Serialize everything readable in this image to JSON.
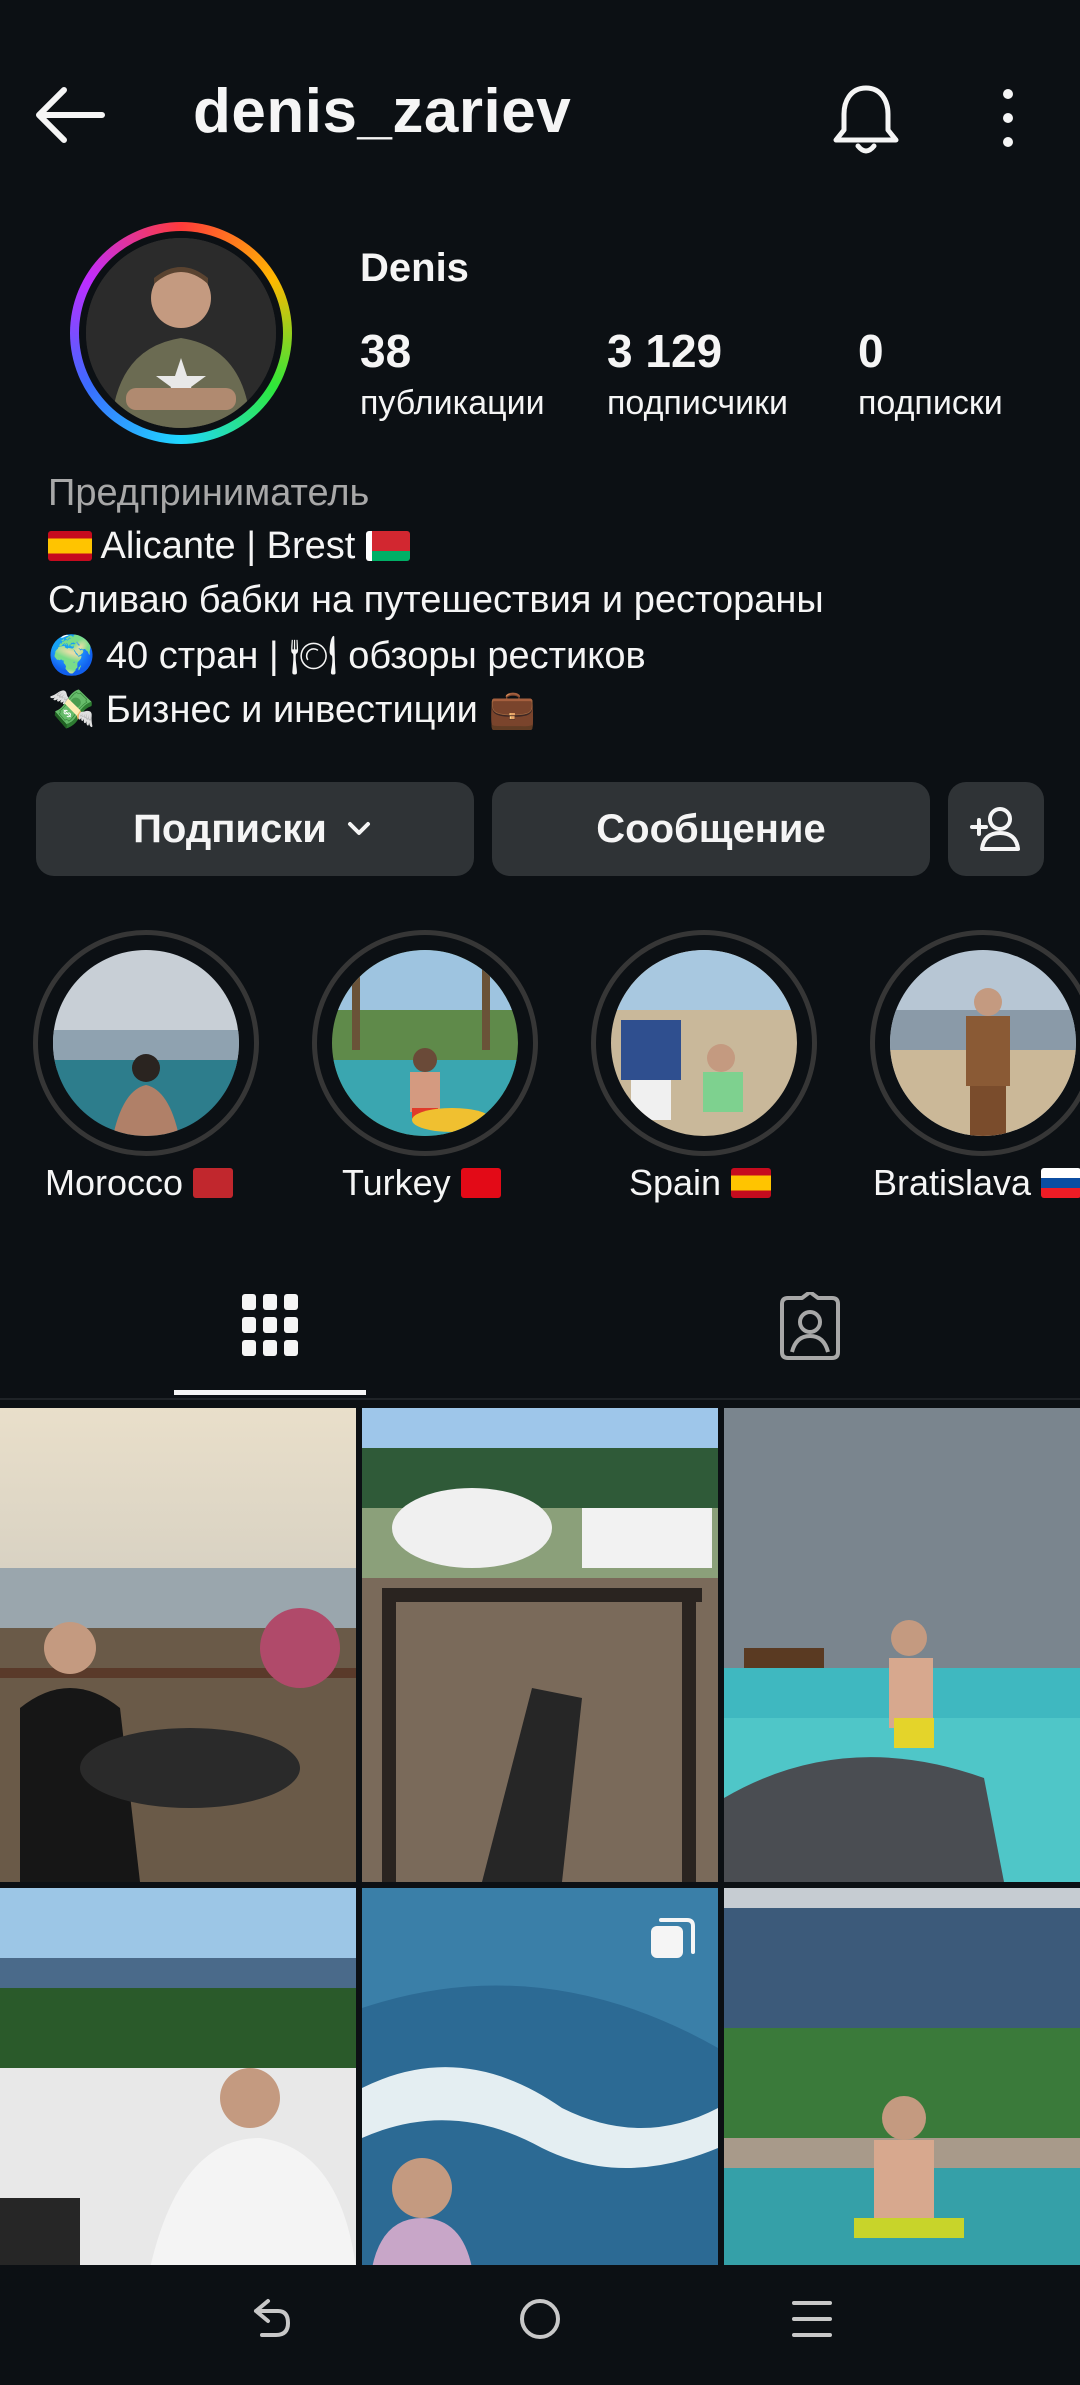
{
  "header": {
    "username": "denis_zariev"
  },
  "profile": {
    "display_name": "Denis",
    "stats": [
      {
        "value": "38",
        "label": "публикации"
      },
      {
        "value": "3 129",
        "label": "подписчики"
      },
      {
        "value": "0",
        "label": "подписки"
      }
    ]
  },
  "bio": {
    "category": "Предприниматель",
    "line1_text": "Alicante | Brest",
    "line2": "Сливаю бабки на путешествия и рестораны",
    "line3_a": "40 стран |",
    "line3_b": "обзоры рестиков",
    "line4": "Бизнес и инвестиции"
  },
  "actions": {
    "following_label": "Подписки",
    "message_label": "Сообщение"
  },
  "highlights": [
    {
      "label": "Morocco"
    },
    {
      "label": "Turkey"
    },
    {
      "label": "Spain"
    },
    {
      "label": "Bratislava"
    }
  ],
  "colors": {
    "background": "#0c1014",
    "button": "#2f3336",
    "text": "#f5f5f5",
    "muted": "#a8a8a8"
  }
}
